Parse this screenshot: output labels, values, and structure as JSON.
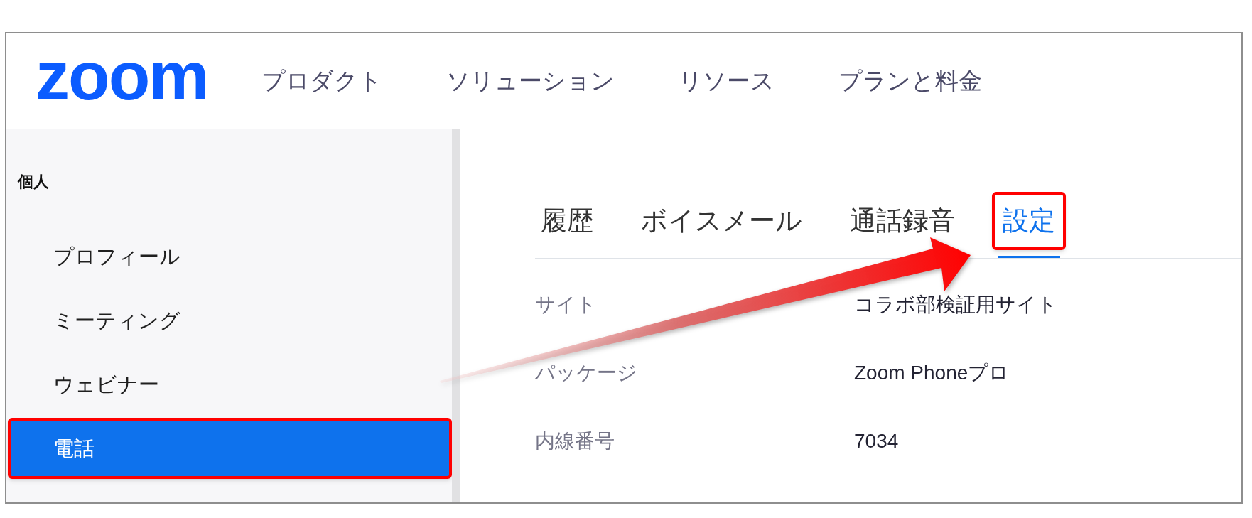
{
  "logo": "zoom",
  "nav": [
    "プロダクト",
    "ソリューション",
    "リソース",
    "プランと料金"
  ],
  "sidebar": {
    "heading": "個人",
    "items": [
      {
        "label": "プロフィール",
        "selected": false,
        "highlighted": false
      },
      {
        "label": "ミーティング",
        "selected": false,
        "highlighted": false
      },
      {
        "label": "ウェビナー",
        "selected": false,
        "highlighted": false
      },
      {
        "label": "電話",
        "selected": true,
        "highlighted": true
      }
    ]
  },
  "tabs": [
    {
      "label": "履歴",
      "selected": false,
      "highlighted": false
    },
    {
      "label": "ボイスメール",
      "selected": false,
      "highlighted": false
    },
    {
      "label": "通話録音",
      "selected": false,
      "highlighted": false
    },
    {
      "label": "設定",
      "selected": true,
      "highlighted": true
    }
  ],
  "details": [
    {
      "label": "サイト",
      "value": "コラボ部検証用サイト"
    },
    {
      "label": "パッケージ",
      "value": "Zoom Phoneプロ"
    },
    {
      "label": "内線番号",
      "value": "7034"
    }
  ]
}
